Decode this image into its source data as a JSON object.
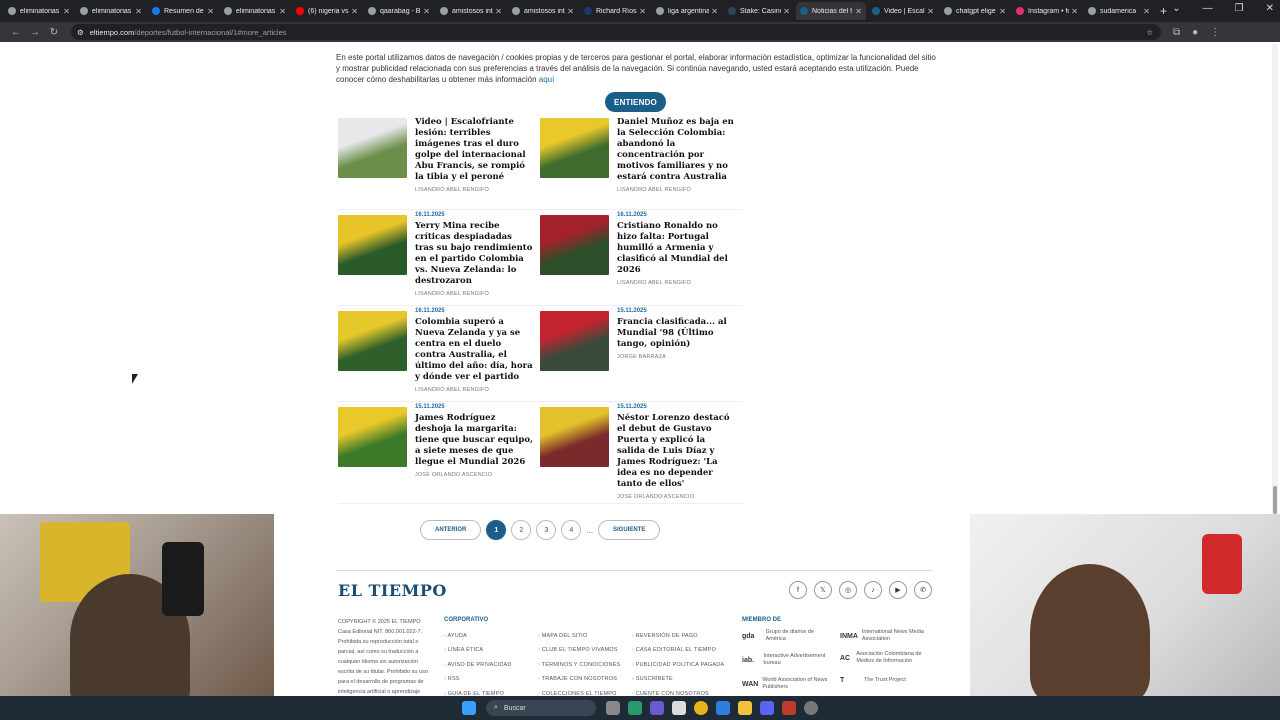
{
  "browser": {
    "tabs": [
      {
        "title": "eliminatorias",
        "color": "#9aa0a6"
      },
      {
        "title": "eliminatorias",
        "color": "#9aa0a6"
      },
      {
        "title": "Resumen de",
        "color": "#1877f2"
      },
      {
        "title": "eliminatorias",
        "color": "#9aa0a6"
      },
      {
        "title": "(6) nigeria vs",
        "color": "#ff0000"
      },
      {
        "title": "qaarabag - B",
        "color": "#9aa0a6"
      },
      {
        "title": "amistosos int",
        "color": "#9aa0a6"
      },
      {
        "title": "amistosos int",
        "color": "#9aa0a6"
      },
      {
        "title": "Richard Ríos",
        "color": "#1b3a6b"
      },
      {
        "title": "liga argentina",
        "color": "#9aa0a6"
      },
      {
        "title": "Stake: Casino",
        "color": "#2f4553"
      },
      {
        "title": "Noticias del f",
        "color": "#1b5e8a"
      },
      {
        "title": "Video | Escalo",
        "color": "#1b5e8a"
      },
      {
        "title": "chatgpt elige",
        "color": "#9aa0a6"
      },
      {
        "title": "Instagram • fo",
        "color": "#e1306c"
      },
      {
        "title": "sudamerica",
        "color": "#9aa0a6"
      }
    ],
    "new_tab": "+",
    "url_domain": "eltiempo.com",
    "url_path": "/deportes/futbol-internacional/1#more_articles"
  },
  "cookie": {
    "text": "En este portal utilizamos datos de navegación / cookies propias y de terceros para gestionar el portal, elaborar información estadística, optimizar la funcionalidad del sitio y mostrar publicidad relacionada con sus preferencias a través del análisis de la navegación. Si continúa navegando, usted estará aceptando esta utilización. Puede conocer cómo deshabilitarlas u obtener más información",
    "link": "aquí",
    "button": "ENTIENDO"
  },
  "articles": [
    {
      "date": "",
      "title": "Video | Escalofriante lesión: terribles imágenes tras el duro golpe del internacional Abu Francis, se rompió la tibia y el peroné",
      "author": "LISANDRO ABEL RENGIFO",
      "c1": "#6b8f4a",
      "c2": "#e8e8ea"
    },
    {
      "date": "",
      "title": "Daniel Muñoz es baja en la Selección Colombia: abandonó la concentración por motivos familiares y no estará contra Australia",
      "author": "LISANDRO ABEL RENGIFO",
      "c1": "#3f6b2e",
      "c2": "#e9c82a"
    },
    {
      "date": "16.11.2025",
      "title": "Yerry Mina recibe críticas despiadadas tras su bajo rendimiento en el partido Colombia vs. Nueva Zelanda: lo destrozaron",
      "author": "LISANDRO ABEL RENGIFO",
      "c1": "#2b5a2a",
      "c2": "#e8c42a"
    },
    {
      "date": "16.11.2025",
      "title": "Cristiano Ronaldo no hizo falta: Portugal humilló a Armenia y clasificó al Mundial del 2026",
      "author": "LISANDRO ABEL RENGIFO",
      "c1": "#2d4f2a",
      "c2": "#a3212a"
    },
    {
      "date": "16.11.2025",
      "title": "Colombia superó a Nueva Zelanda y ya se centra en el duelo contra Australia, el último del año: día, hora y dónde ver el partido",
      "author": "LISANDRO ABEL RENGIFO",
      "c1": "#2f5f2a",
      "c2": "#e6c82c"
    },
    {
      "date": "15.11.2025",
      "title": "Francia clasificada... al Mundial '98 (Último tango, opinión)",
      "author": "JORGE BARRAZA",
      "c1": "#3a4a3a",
      "c2": "#c32430"
    },
    {
      "date": "15.11.2025",
      "title": "James Rodríguez deshoja la margarita: tiene que buscar equipo, a siete meses de que llegue el Mundial 2026",
      "author": "JOSÉ ORLANDO ASCENCIO",
      "c1": "#3c7a2a",
      "c2": "#e8c82a"
    },
    {
      "date": "15.11.2025",
      "title": "Néstor Lorenzo destacó el debut de Gustavo Puerta y explicó la salida de Luis Díaz y James Rodríguez: 'La idea es no depender tanto de ellos'",
      "author": "JOSÉ ORLANDO ASCENCIO",
      "c1": "#7a2a2a",
      "c2": "#e3c12c"
    }
  ],
  "pagination": {
    "prev": "ANTERIOR",
    "pages": [
      "1",
      "2",
      "3",
      "4"
    ],
    "ellipsis": "...",
    "next": "SIGUIENTE"
  },
  "footer": {
    "logo": "EL TIEMPO",
    "socials": [
      "f",
      "𝕏",
      "◎",
      "♪",
      "▶",
      "✆"
    ],
    "copyright": "COPYRIGHT © 2025 EL TIEMPO Casa Editorial NIT. 860.001.022-7. Prohibida su reproducción total o parcial, así como su traducción a cualquier idioma sin autorización escrita de su titular. Prohibido su uso para el desarrollo de programas de inteligencia artificial o aprendizaje automático, así como su traducción a cualquier",
    "corporativo_heading": "CORPORATIVO",
    "col1": [
      "AYUDA",
      "LÍNEA ÉTICA",
      "AVISO DE PRIVACIDAD",
      "RSS",
      "GUÍA DE EL TIEMPO"
    ],
    "col2": [
      "MAPA DEL SITIO",
      "CLUB EL TIEMPO VIVAMOS",
      "TÉRMINOS Y CONDICIONES",
      "TRABAJE CON NOSOTROS",
      "COLECCIONES EL TIEMPO"
    ],
    "col3": [
      "REVERSIÓN DE PAGO",
      "CASA EDITORIAL EL TIEMPO",
      "PUBLICIDAD POLÍTICA PAGADA",
      "SUSCRÍBETE",
      "CUENTE CON NOSOTROS"
    ],
    "member_heading": "MIEMBRO DE",
    "members": [
      {
        "mark": "gda",
        "name": "Grupo de diarios de América"
      },
      {
        "mark": "iab.",
        "name": "Interactive Advertisement bureau"
      },
      {
        "mark": "WAN",
        "name": "World Association of News Publishers"
      },
      {
        "mark": "INMA",
        "name": "International News Media Association"
      },
      {
        "mark": "AC",
        "name": "Asociación Colombiana de Medios de Información"
      },
      {
        "mark": "T",
        "name": "The Trust Project"
      }
    ]
  },
  "taskbar": {
    "search": "Buscar"
  }
}
